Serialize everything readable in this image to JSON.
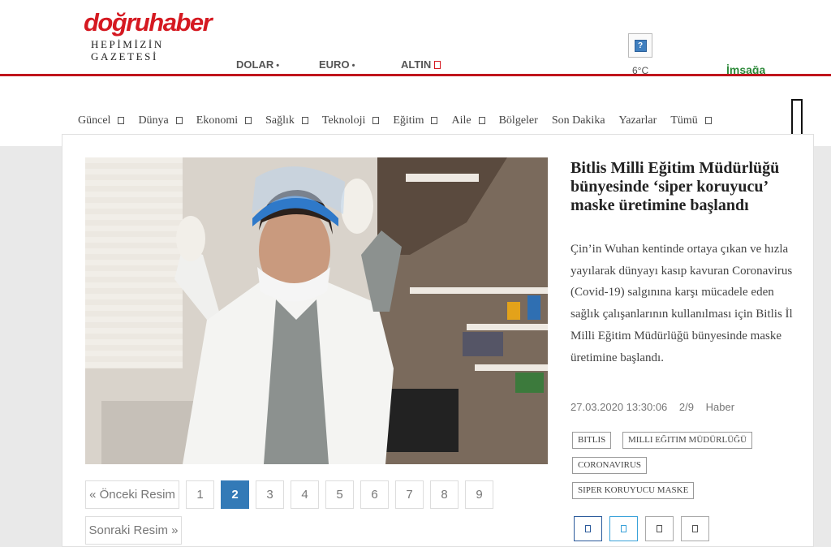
{
  "brand": {
    "logo_text": "doğruhaber",
    "tagline": "HEPİMİZİN GAZETESİ",
    "color": "#d51921"
  },
  "markets": [
    "DOLAR",
    "EURO",
    "ALTIN"
  ],
  "weather": {
    "temp": "6°C",
    "icon": "weather-icon"
  },
  "prayer": {
    "label": "İmsağa"
  },
  "nav": [
    {
      "label": "Güncel",
      "dropdown": true
    },
    {
      "label": "Dünya",
      "dropdown": true
    },
    {
      "label": "Ekonomi",
      "dropdown": true
    },
    {
      "label": "Sağlık",
      "dropdown": true
    },
    {
      "label": "Teknoloji",
      "dropdown": true
    },
    {
      "label": "Eğitim",
      "dropdown": true
    },
    {
      "label": "Aile",
      "dropdown": true
    },
    {
      "label": "Bölgeler",
      "dropdown": false
    },
    {
      "label": "Son Dakika",
      "dropdown": false
    },
    {
      "label": "Yazarlar",
      "dropdown": false
    },
    {
      "label": "Tümü",
      "dropdown": true
    }
  ],
  "article": {
    "headline": "Bitlis Milli Eğitim Müdürlüğü bünyesinde ‘siper koruyucu’ maske üretimine başlandı",
    "summary": "Çin’in Wuhan kentinde ortaya çıkan ve hızla yayılarak dünyayı kasıp kavuran Coronavirus (Covid-19) salgınına karşı mücadele eden sağlık çalışanlarının kullanılması için Bitlis İl Milli Eğitim Müdürlüğü bünyesinde maske üretimine başlandı.",
    "date": "27.03.2020 13:30:06",
    "position": "2/9",
    "category": "Haber",
    "tags": [
      "BITLIS",
      "MILLI EĞITIM MÜDÜRLÜĞÜ",
      "CORONAVIRUS",
      "SIPER KORUYUCU MASKE"
    ]
  },
  "pagination": {
    "prev_label": "« Önceki Resim",
    "next_label": "Sonraki Resim »",
    "pages": [
      "1",
      "2",
      "3",
      "4",
      "5",
      "6",
      "7",
      "8",
      "9"
    ],
    "current": "2"
  },
  "share_buttons": [
    "facebook",
    "twitter",
    "whatsapp",
    "email"
  ],
  "colors": {
    "accent_red": "#c0141c",
    "pagination_active": "#337ab7"
  }
}
